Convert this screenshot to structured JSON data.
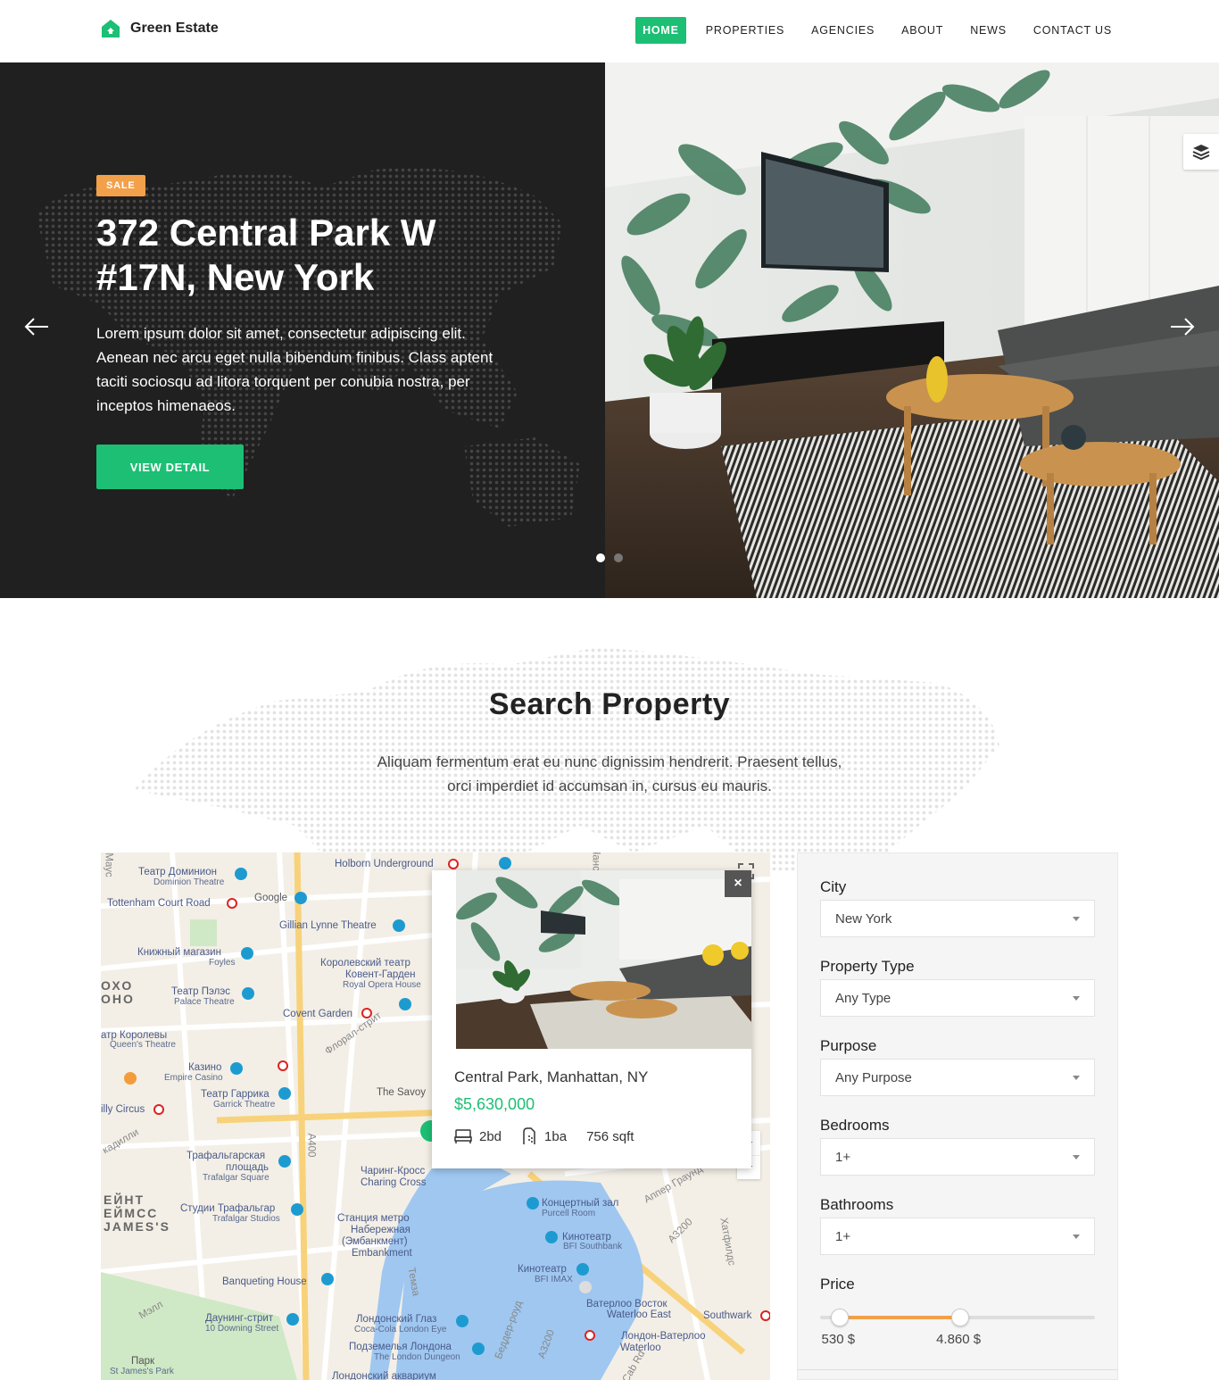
{
  "brand": {
    "name": "Green Estate",
    "accent": "#1cbf74"
  },
  "nav": {
    "items": [
      {
        "label": "HOME",
        "active": true
      },
      {
        "label": "PROPERTIES",
        "active": false
      },
      {
        "label": "AGENCIES",
        "active": false
      },
      {
        "label": "ABOUT",
        "active": false
      },
      {
        "label": "NEWS",
        "active": false
      },
      {
        "label": "CONTACT US",
        "active": false
      }
    ]
  },
  "hero": {
    "badge": "SALE",
    "title_line1": "372 Central Park W",
    "title_line2": "#17N, New York",
    "description": "Lorem ipsum dolor sit amet, consectetur adipiscing elit. Aenean nec arcu eget nulla bibendum finibus. Class aptent taciti sociosqu ad litora torquent per conubia nostra, per inceptos himenaeos.",
    "cta": "VIEW DETAIL",
    "slides_total": 2,
    "active_slide": 1
  },
  "search": {
    "title": "Search Property",
    "subtitle_line1": "Aliquam fermentum erat eu nunc dignissim hendrerit. Praesent tellus,",
    "subtitle_line2": "orci imperdiet id accumsan in, cursus eu mauris."
  },
  "map": {
    "labels": [
      "Театр Доминион",
      "Dominion Theatre",
      "Holborn Underground",
      "Tottenham Court Road",
      "Google",
      "Gillian Lynne Theatre",
      "Книжный магазин",
      "Foyles",
      "Королевский театр",
      "Ковент-Гарден",
      "Royal Opera House",
      "Театр Пэлэс",
      "Palace Theatre",
      "Covent Garden",
      "атр Королевы",
      "Queen's Theatre",
      "Казино",
      "Empire Casino",
      "Театр Гаррика",
      "Garrick Theatre",
      "The Savoy",
      "illy Circus",
      "Трафальгарская",
      "площадь",
      "Trafalgar Square",
      "Чаринг-Кросс",
      "Charing Cross",
      "Студии Трафальгар",
      "Trafalgar Studios",
      "Станция метро",
      "Набережная",
      "(Эмбанкмент)",
      "Embankment",
      "Концертный зал",
      "Purcell Room",
      "Кинотеатр",
      "BFI Southbank",
      "Кинотеатр",
      "BFI IMAX",
      "Banqueting House",
      "Даунинг-стрит",
      "10 Downing Street",
      "Лондонский Глаз",
      "Coca-Cola London Eye",
      "Ватерлоо Восток",
      "Waterloo East",
      "Southwark",
      "Подземелья Лондона",
      "The London Dungeon",
      "Лондон-Ватерлоо",
      "Waterloo",
      "Парк",
      "St James's Park",
      "Лондонский аквариум",
      "ОХО",
      "ОНО",
      "ЕЙНТ",
      "ЕЙМСС",
      "JAMES'S",
      "A400",
      "A3200",
      "A3200",
      "Темза",
      "Мэлл",
      "кадилли",
      "Флорал-стрит",
      "Беддер-роуд",
      "Аппер Граунд",
      "Хатфилдс",
      "Cab Rd",
      "Айнс",
      "Чансе",
      "Маус"
    ]
  },
  "popup": {
    "address": "Central Park, Manhattan, NY",
    "price": "$5,630,000",
    "beds": "2bd",
    "baths": "1ba",
    "area": "756 sqft",
    "close_label": "×"
  },
  "filters": {
    "city": {
      "label": "City",
      "value": "New York"
    },
    "type": {
      "label": "Property Type",
      "value": "Any Type"
    },
    "purpose": {
      "label": "Purpose",
      "value": "Any Purpose"
    },
    "bedrooms": {
      "label": "Bedrooms",
      "value": "1+"
    },
    "bathrooms": {
      "label": "Bathrooms",
      "value": "1+"
    },
    "price": {
      "label": "Price",
      "min": "530 $",
      "max": "4.860 $",
      "min_frac": 0.07,
      "max_frac": 0.51
    }
  },
  "colors": {
    "accent": "#1cbf74",
    "orange": "#f3a04a",
    "hero_dark": "#202020"
  }
}
